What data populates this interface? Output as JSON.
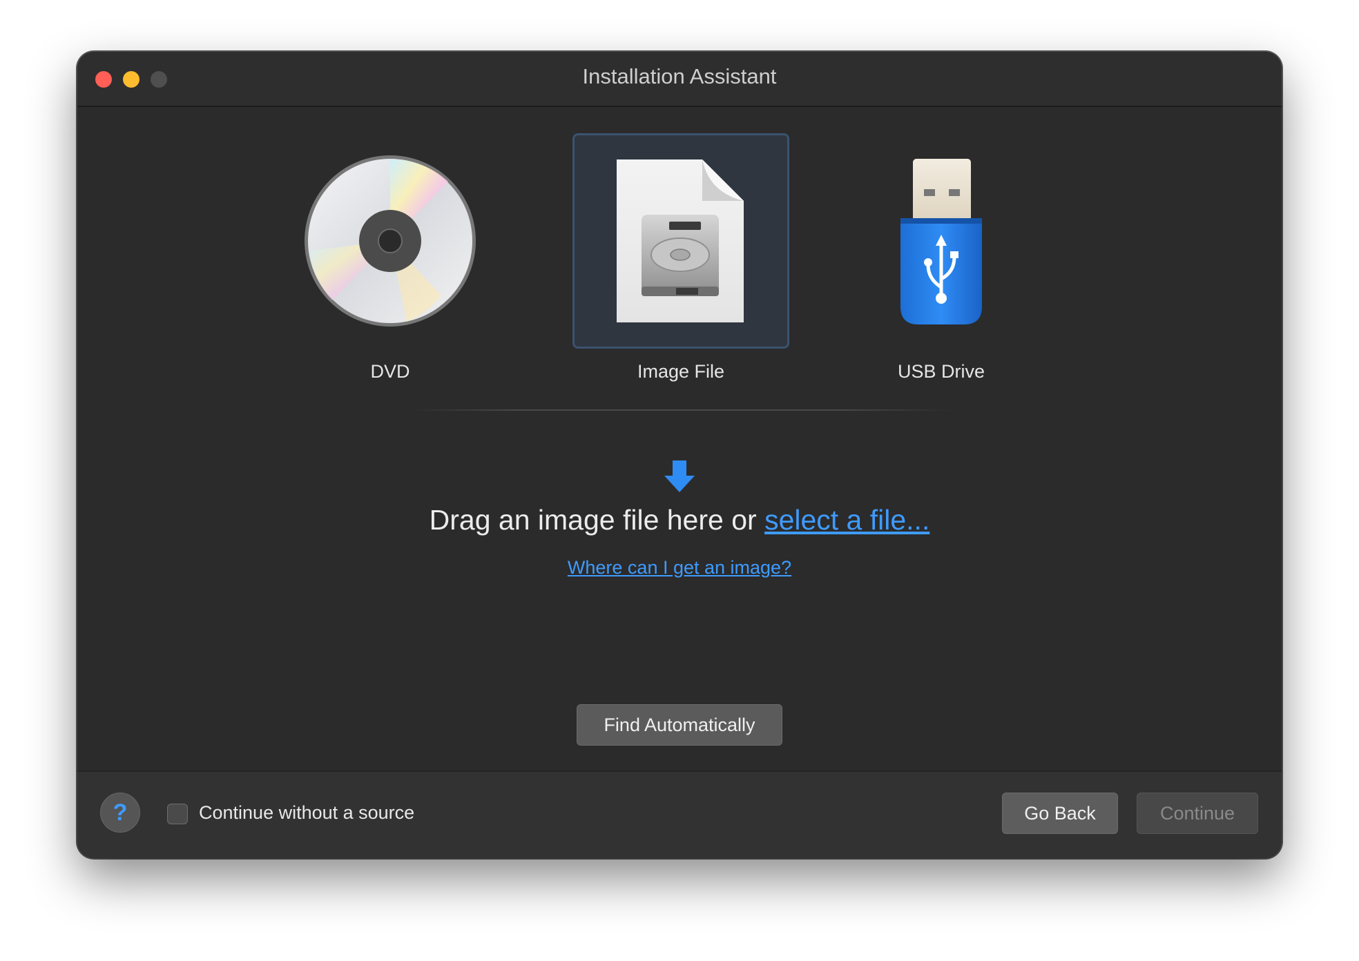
{
  "window": {
    "title": "Installation Assistant"
  },
  "sources": {
    "items": [
      {
        "label": "DVD",
        "icon": "dvd-disc-icon",
        "selected": false
      },
      {
        "label": "Image File",
        "icon": "disk-image-file-icon",
        "selected": true
      },
      {
        "label": "USB Drive",
        "icon": "usb-drive-icon",
        "selected": false
      }
    ]
  },
  "drop_zone": {
    "text": "Drag an image file here or ",
    "link": "select a file...",
    "help_link": "Where can I get an image?",
    "icon": "down-arrow-icon",
    "accent_color": "#3f9bff"
  },
  "actions": {
    "find_automatically": "Find Automatically"
  },
  "footer": {
    "help_icon_text": "?",
    "checkbox_label": "Continue without a source",
    "checkbox_checked": false,
    "go_back": "Go Back",
    "continue": "Continue",
    "continue_enabled": false
  }
}
